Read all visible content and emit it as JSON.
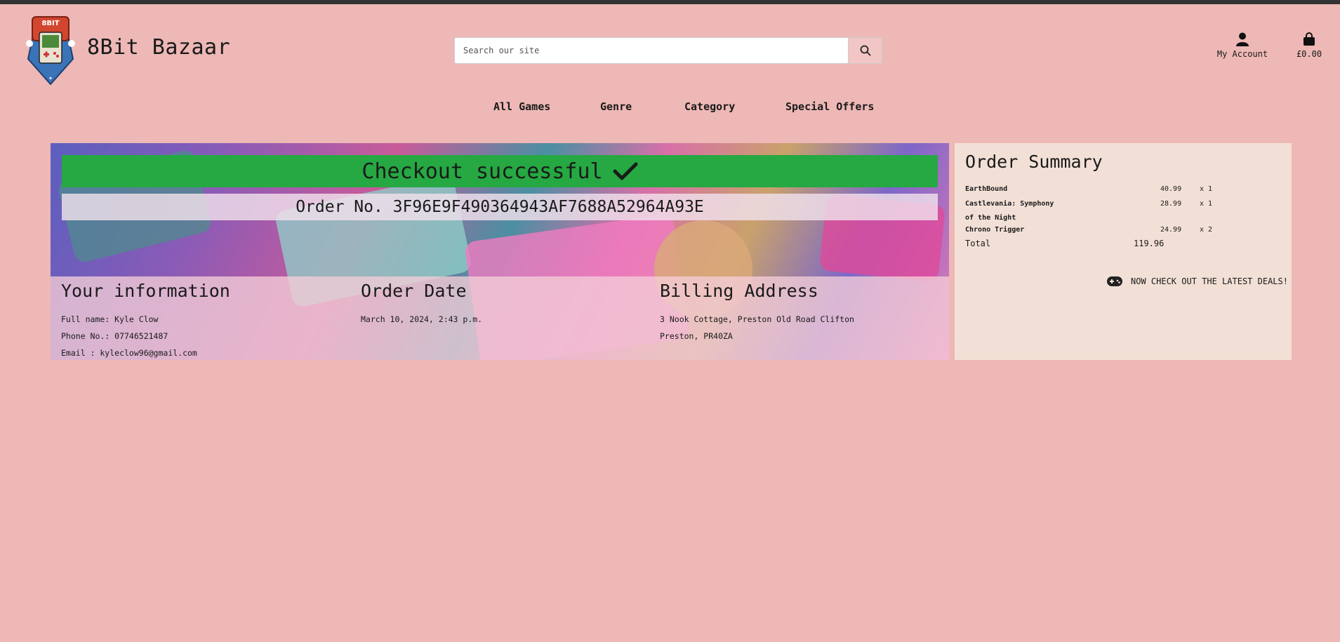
{
  "header": {
    "brand": "8Bit Bazaar",
    "search_placeholder": "Search our site",
    "account_label": "My Account",
    "basket_total": "£0.00"
  },
  "nav": [
    "All Games",
    "Genre",
    "Category",
    "Special Offers"
  ],
  "checkout": {
    "success_text": "Checkout successful",
    "order_number": "Order No. 3F96E9F490364943AF7688A52964A93E"
  },
  "customer": {
    "heading": "Your information",
    "full_name": "Full name: Kyle Clow",
    "phone": "Phone No.: 07746521487",
    "email": "Email : kyleclow96@gmail.com"
  },
  "order_date": {
    "heading": "Order Date",
    "value": "March 10, 2024, 2:43 p.m."
  },
  "billing": {
    "heading": "Billing Address",
    "line1": "3 Nook Cottage, Preston Old Road Clifton",
    "line2": "Preston, PR40ZA"
  },
  "summary": {
    "heading": "Order Summary",
    "items": [
      {
        "name": "EarthBound",
        "price": "40.99",
        "qty": "x 1"
      },
      {
        "name": "Castlevania: Symphony of the Night",
        "price": "28.99",
        "qty": "x 1"
      },
      {
        "name": "Chrono Trigger",
        "price": "24.99",
        "qty": "x 2"
      }
    ],
    "total_label": "Total",
    "total_value": "119.96",
    "deals_label": "NOW CHECK OUT THE LATEST DEALS!"
  },
  "colors": {
    "page_bg": "#edb8b6",
    "success_bg": "#26a843",
    "summary_bg": "#f2e0d6"
  }
}
